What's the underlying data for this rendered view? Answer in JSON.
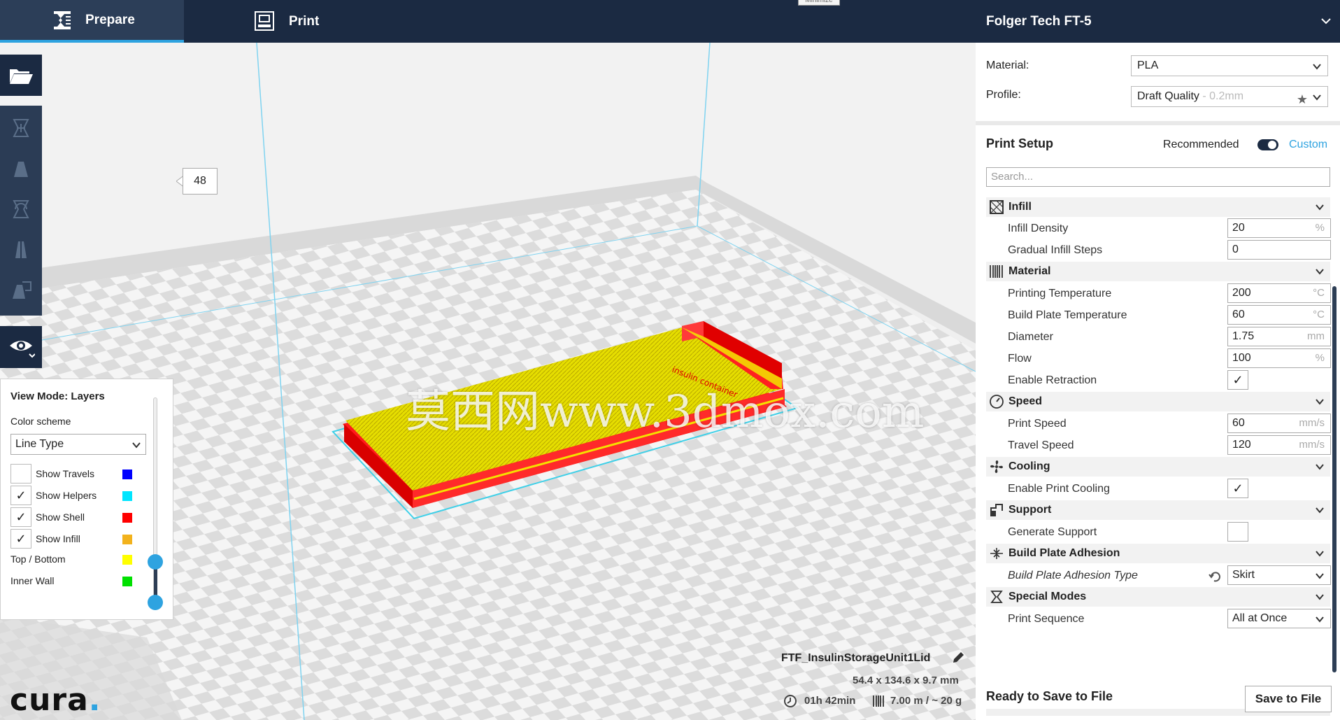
{
  "topbar": {
    "tab_prepare": "Prepare",
    "tab_print": "Print",
    "machine_name": "Folger Tech FT-5",
    "tooltip": "Minimize"
  },
  "view_panel": {
    "title": "View Mode: Layers",
    "color_scheme_label": "Color scheme",
    "color_scheme_value": "Line Type",
    "rows": [
      {
        "label": "Show Travels",
        "checked": false,
        "color": "#0000ff"
      },
      {
        "label": "Show Helpers",
        "checked": true,
        "color": "#00e5ff"
      },
      {
        "label": "Show Shell",
        "checked": true,
        "color": "#ff0000"
      },
      {
        "label": "Show Infill",
        "checked": true,
        "color": "#f2b21c"
      },
      {
        "label": "Top / Bottom",
        "checked": null,
        "color": "#ffff00"
      },
      {
        "label": "Inner Wall",
        "checked": null,
        "color": "#00e000"
      }
    ],
    "layer_value": "48",
    "check_mark": "✓"
  },
  "right_panel": {
    "material_label": "Material:",
    "material_value": "PLA",
    "profile_label": "Profile:",
    "profile_value": "Draft Quality",
    "profile_sub": " - 0.2mm",
    "star": "★",
    "print_setup_title": "Print Setup",
    "recommended": "Recommended",
    "custom": "Custom",
    "search_placeholder": "Search...",
    "categories": {
      "infill": "Infill",
      "material": "Material",
      "speed": "Speed",
      "cooling": "Cooling",
      "support": "Support",
      "adhesion": "Build Plate Adhesion",
      "special": "Special Modes"
    },
    "settings": {
      "infill_density": {
        "label": "Infill Density",
        "value": "20",
        "unit": "%"
      },
      "gradual_infill": {
        "label": "Gradual Infill Steps",
        "value": "0"
      },
      "print_temp": {
        "label": "Printing Temperature",
        "value": "200",
        "unit": "°C"
      },
      "bed_temp": {
        "label": "Build Plate Temperature",
        "value": "60",
        "unit": "°C"
      },
      "diameter": {
        "label": "Diameter",
        "value": "1.75",
        "unit": "mm"
      },
      "flow": {
        "label": "Flow",
        "value": "100",
        "unit": "%"
      },
      "retraction": {
        "label": "Enable Retraction",
        "checked": "✓"
      },
      "print_speed": {
        "label": "Print Speed",
        "value": "60",
        "unit": "mm/s"
      },
      "travel_speed": {
        "label": "Travel Speed",
        "value": "120",
        "unit": "mm/s"
      },
      "print_cooling": {
        "label": "Enable Print Cooling",
        "checked": "✓"
      },
      "gen_support": {
        "label": "Generate Support",
        "checked": ""
      },
      "adhesion_type": {
        "label": "Build Plate Adhesion Type",
        "value": "Skirt"
      },
      "print_sequence": {
        "label": "Print Sequence",
        "value": "All at Once"
      }
    },
    "ready_title": "Ready to Save to File",
    "save_button": "Save to File"
  },
  "object_info": {
    "name": "FTF_InsulinStorageUnit1Lid",
    "dimensions": "54.4 x 134.6 x 9.7 mm",
    "time": "01h 42min",
    "material_usage": "7.00 m / ~ 20 g"
  },
  "logo": {
    "text": "cura",
    "dot": "."
  },
  "watermark": "莫西网www.3dmox.com",
  "colors": {
    "accent": "#2ea3e0",
    "topbar": "#1b2a42",
    "model_top": "#e8e000",
    "model_shell": "#ff0000"
  }
}
